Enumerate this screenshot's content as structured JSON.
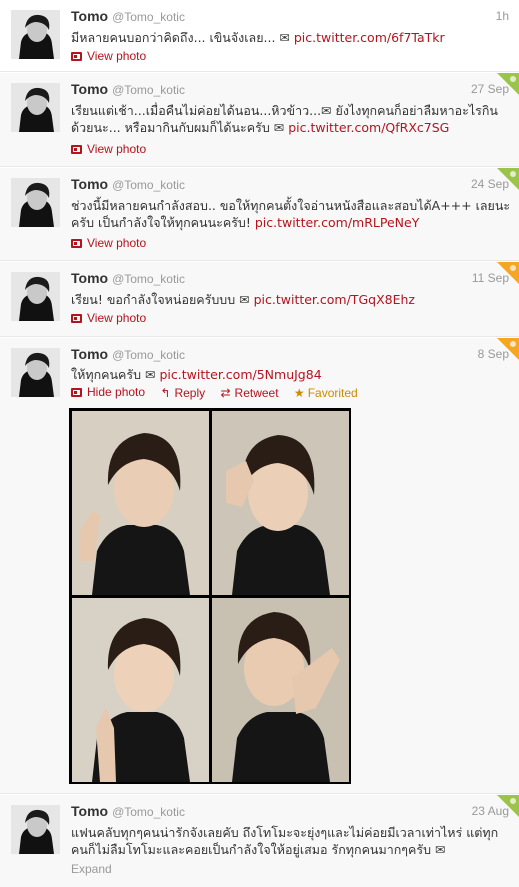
{
  "colors": {
    "link": "#b4141e",
    "meta": "#999999",
    "favorited": "#cc8a00",
    "retweet_ribbon": "#9bc54a",
    "favorite_ribbon": "#f5a623"
  },
  "tweets": [
    {
      "name": "Tomo",
      "handle": "@Tomo_kotic",
      "time": "1h",
      "text": "มีหลายคนบอกว่าคิดถึง... เขินจังเลย... ✉ ",
      "link": "pic.twitter.com/6f7TaTkr",
      "action": "View photo"
    },
    {
      "name": "Tomo",
      "handle": "@Tomo_kotic",
      "time": "27 Sep",
      "text": "เรียนแต่เช้า...เมื่อคืนไม่ค่อยได้นอน...หิวข้าว...✉ ยังไงทุกคนก็อย่าลืมหาอะไรกินด้วยนะ... หรือมากินกับผมก็ได้นะครับ ✉ ",
      "link": "pic.twitter.com/QfRXc7SG",
      "action": "View photo"
    },
    {
      "name": "Tomo",
      "handle": "@Tomo_kotic",
      "time": "24 Sep",
      "text": "ช่วงนี้มีหลายคนกำลังสอบ.. ขอให้ทุกคนตั้งใจอ่านหนังสือและสอบได้A+++ เลยนะครับ เป็นกำลังใจให้ทุกคนนะครับ! ",
      "link": "pic.twitter.com/mRLPeNeY",
      "action": "View photo"
    },
    {
      "name": "Tomo",
      "handle": "@Tomo_kotic",
      "time": "11 Sep",
      "text": "เรียน! ขอกำลังใจหน่อยครับบบ ✉ ",
      "link": "pic.twitter.com/TGqX8Ehz",
      "action": "View photo"
    },
    {
      "name": "Tomo",
      "handle": "@Tomo_kotic",
      "time": "8 Sep",
      "text": "ให้ทุกคนครับ ✉ ",
      "link": "pic.twitter.com/5NmuJg84",
      "hide": "Hide photo",
      "reply": "Reply",
      "retweet": "Retweet",
      "favorited": "Favorited"
    },
    {
      "name": "Tomo",
      "handle": "@Tomo_kotic",
      "time": "23 Aug",
      "text": "แฟนคลับทุกๆคนน่ารักจังเลยคับ ถึงโทโมะจะยุ่งๆและไม่ค่อยมีเวลาเท่าไหร่ แต่ทุกคนก็ไม่ลืมโทโมะและคอยเป็นกำลังใจให้อยู่เสมอ รักทุกคนมากๆครับ ✉",
      "action": "Expand"
    }
  ]
}
